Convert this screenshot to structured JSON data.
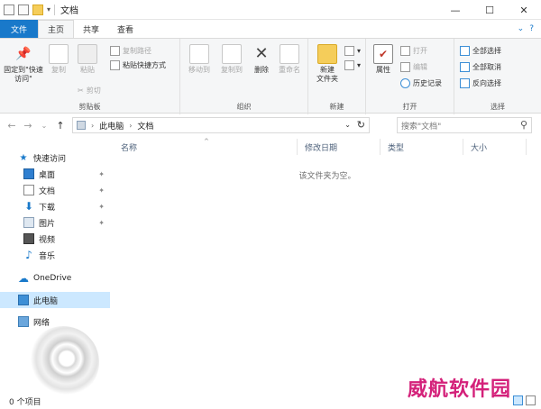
{
  "window": {
    "title": "文档",
    "controls": {
      "minimize": "—",
      "maximize": "☐",
      "close": "✕"
    }
  },
  "tabs": [
    {
      "label": "文件"
    },
    {
      "label": "主页"
    },
    {
      "label": "共享"
    },
    {
      "label": "查看"
    }
  ],
  "ribbon": {
    "clipboard": {
      "label": "剪贴板",
      "pin": "固定到\"快速访问\"",
      "copy": "复制",
      "paste": "粘贴",
      "copy_path": "复制路径",
      "paste_shortcut": "粘贴快捷方式",
      "cut": "剪切"
    },
    "organize": {
      "label": "组织",
      "move_to": "移动到",
      "copy_to": "复制到",
      "delete": "删除",
      "rename": "重命名"
    },
    "new": {
      "label": "新建",
      "new_folder": "新建\n文件夹"
    },
    "open": {
      "label": "打开",
      "properties": "属性",
      "open": "打开",
      "edit": "编辑",
      "history": "历史记录"
    },
    "select": {
      "label": "选择",
      "select_all": "全部选择",
      "select_none": "全部取消",
      "invert": "反向选择"
    }
  },
  "address": {
    "crumbs": [
      "此电脑",
      "文档"
    ],
    "search_placeholder": "搜索\"文档\""
  },
  "navpane": {
    "quick_access": "快速访问",
    "items": [
      {
        "label": "桌面"
      },
      {
        "label": "文档"
      },
      {
        "label": "下载"
      },
      {
        "label": "图片"
      },
      {
        "label": "视频"
      },
      {
        "label": "音乐"
      }
    ],
    "onedrive": "OneDrive",
    "this_pc": "此电脑",
    "network": "网络"
  },
  "columns": [
    "名称",
    "修改日期",
    "类型",
    "大小"
  ],
  "empty_message": "该文件夹为空。",
  "status": {
    "count": "0 个项目"
  },
  "watermark": "威航软件园",
  "colors": {
    "accent": "#1979ca",
    "selection": "#cce8ff",
    "watermark": "#d4217a"
  }
}
